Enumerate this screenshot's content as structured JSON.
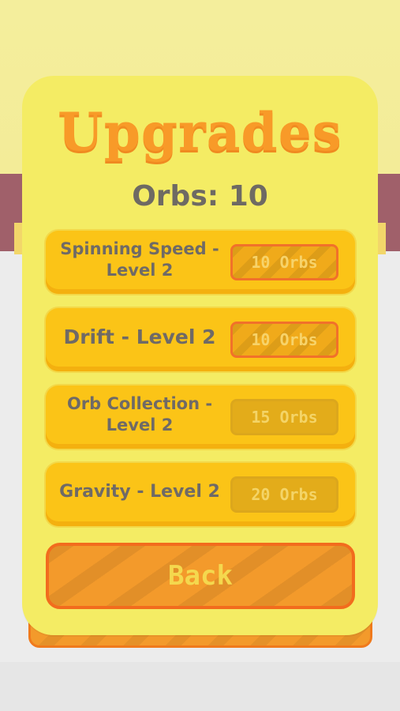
{
  "screen": {
    "title": "Upgrades",
    "orbs_label": "Orbs: 10"
  },
  "upgrades": [
    {
      "name": "Spinning Speed - Level 2",
      "cost": "10 Orbs",
      "affordable": true
    },
    {
      "name": "Drift - Level 2",
      "cost": "10 Orbs",
      "affordable": true
    },
    {
      "name": "Orb Collection - Level 2",
      "cost": "15 Orbs",
      "affordable": false
    },
    {
      "name": "Gravity - Level 2",
      "cost": "20 Orbs",
      "affordable": false
    }
  ],
  "back_label": "Back",
  "colors": {
    "panel": "#f4ec64",
    "row": "#fbc417",
    "title": "#f89a28",
    "button": "#f39a2b",
    "button_border": "#f26c1d",
    "text_gray": "#6e6a63"
  }
}
